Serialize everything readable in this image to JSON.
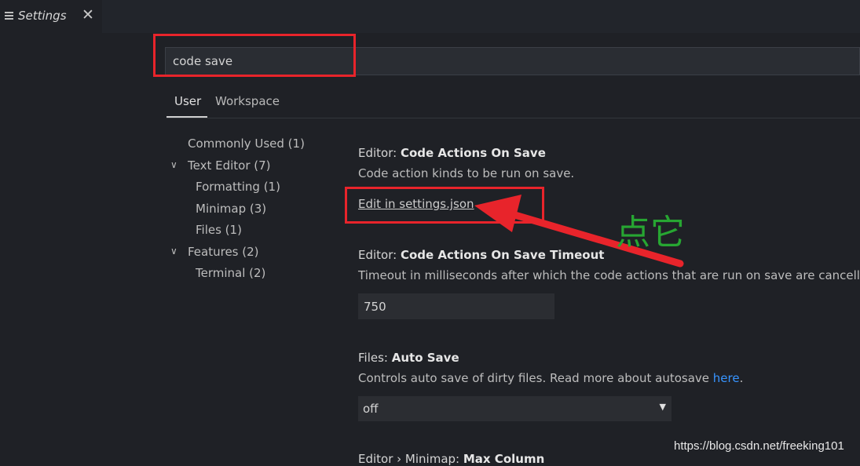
{
  "tab": {
    "label": "Settings",
    "close": "✕",
    "icon": "list-icon"
  },
  "search": {
    "value": "code save",
    "placeholder": ""
  },
  "scopes": {
    "user": "User",
    "workspace": "Workspace"
  },
  "toc": {
    "commonly_used": "Commonly Used (1)",
    "text_editor": "Text Editor (7)",
    "formatting": "Formatting (1)",
    "minimap": "Minimap (3)",
    "files": "Files (1)",
    "features": "Features (2)",
    "terminal": "Terminal (2)",
    "chevron": "∨"
  },
  "settings": {
    "code_actions": {
      "category": "Editor: ",
      "name": "Code Actions On Save",
      "description": "Code action kinds to be run on save.",
      "link": "Edit in settings.json"
    },
    "timeout": {
      "category": "Editor: ",
      "name": "Code Actions On Save Timeout",
      "description": "Timeout in milliseconds after which the code actions that are run on save are cancelled.",
      "value": "750"
    },
    "auto_save": {
      "category": "Files: ",
      "name": "Auto Save",
      "description": "Controls auto save of dirty files. Read more about autosave ",
      "link": "here",
      "link_suffix": ".",
      "value": "off",
      "arrow": "▼"
    },
    "minimap": {
      "category": "Editor › Minimap: ",
      "name": "Max Column"
    }
  },
  "annotation": "点它",
  "watermark": "https://blog.csdn.net/freeking101",
  "colors": {
    "highlight": "#e8242b",
    "annotation": "#27a632",
    "link": "#3794ff",
    "background": "#1f2126"
  }
}
